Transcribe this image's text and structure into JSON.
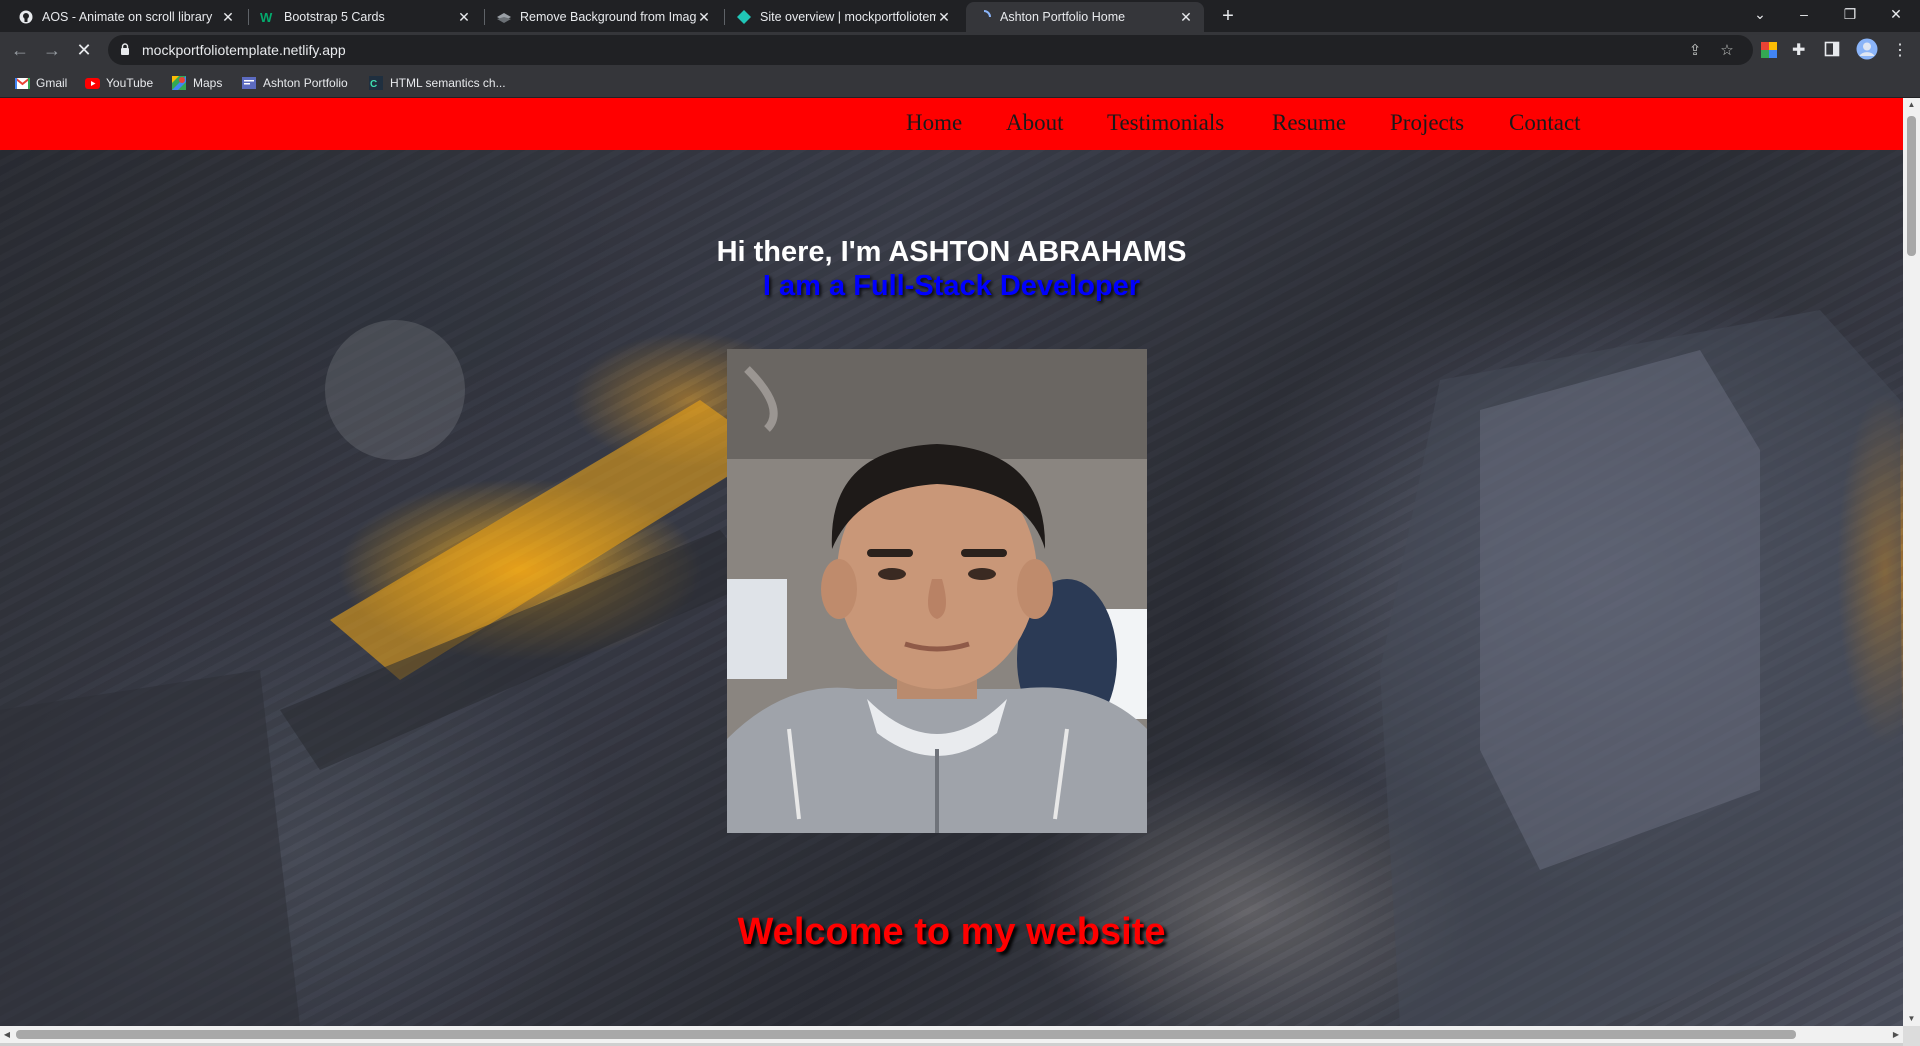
{
  "browser": {
    "tabs": [
      {
        "label": "AOS - Animate on scroll library",
        "icon": "github-icon"
      },
      {
        "label": "Bootstrap 5 Cards",
        "icon": "w3schools-icon"
      },
      {
        "label": "Remove Background from Image",
        "icon": "removebg-icon"
      },
      {
        "label": "Site overview | mockportfoliotem",
        "icon": "netlify-icon"
      },
      {
        "label": "Ashton Portfolio Home",
        "icon": "loading-icon",
        "active": true
      }
    ],
    "new_tab": "+",
    "url": "mockportfoliotemplate.netlify.app",
    "window_controls": {
      "tab_search": "⌄",
      "minimize": "–",
      "restore": "❐",
      "close": "✕"
    },
    "bookmarks": [
      {
        "label": "Gmail",
        "icon": "gmail-icon"
      },
      {
        "label": "YouTube",
        "icon": "youtube-icon"
      },
      {
        "label": "Maps",
        "icon": "maps-icon"
      },
      {
        "label": "Ashton Portfolio",
        "icon": "portfolio-icon"
      },
      {
        "label": "HTML semantics ch...",
        "icon": "codecademy-icon"
      }
    ]
  },
  "page": {
    "colors": {
      "navbar": "#ff0000",
      "subtitle": "#0000ff",
      "welcome": "#ff0000"
    },
    "nav": [
      "Home",
      "About",
      "Testimonials",
      "Resume",
      "Projects",
      "Contact"
    ],
    "hero_title": "Hi there, I'm ASHTON ABRAHAMS",
    "hero_subtitle": "I am a Full-Stack Developer",
    "welcome": "Welcome to my website"
  }
}
